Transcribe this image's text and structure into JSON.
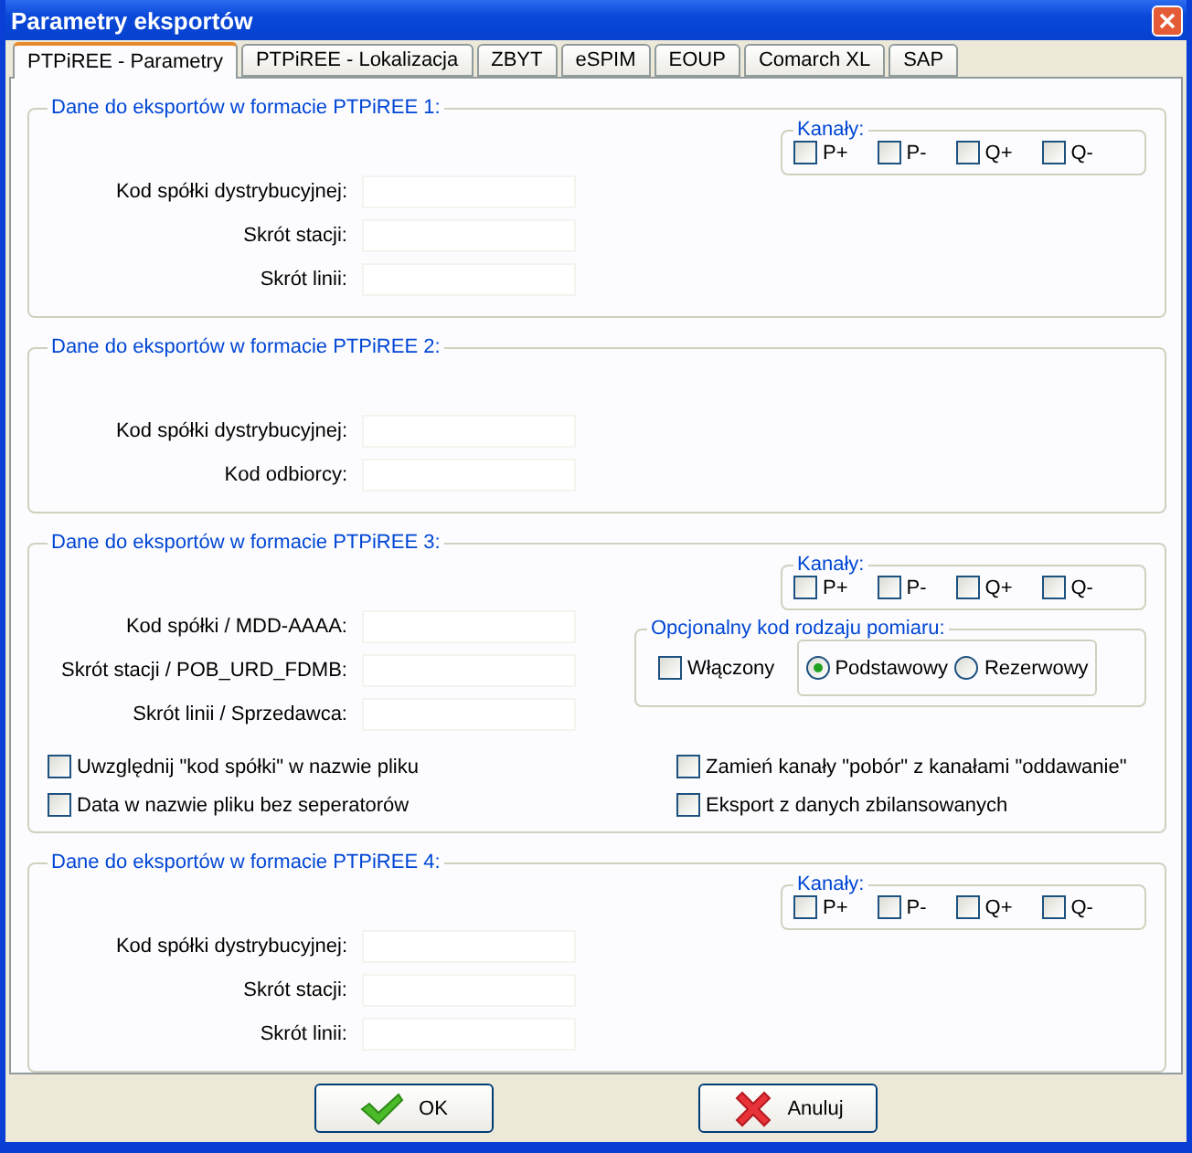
{
  "window": {
    "title": "Parametry eksportów"
  },
  "tabs": [
    {
      "label": "PTPiREE - Parametry",
      "selected": true
    },
    {
      "label": "PTPiREE - Lokalizacja",
      "selected": false
    },
    {
      "label": "ZBYT",
      "selected": false
    },
    {
      "label": "eSPIM",
      "selected": false
    },
    {
      "label": "EOUP",
      "selected": false
    },
    {
      "label": "Comarch XL",
      "selected": false
    },
    {
      "label": "SAP",
      "selected": false
    }
  ],
  "groups": [
    {
      "title": "Dane do eksportów w formacie PTPiREE 1:",
      "channels": {
        "title": "Kanały:",
        "items": [
          {
            "label": "P+",
            "checked": false
          },
          {
            "label": "P-",
            "checked": false
          },
          {
            "label": "Q+",
            "checked": false
          },
          {
            "label": "Q-",
            "checked": false
          }
        ]
      },
      "fields": [
        {
          "label": "Kod spółki dystrybucyjnej:"
        },
        {
          "label": "Skrót stacji:"
        },
        {
          "label": "Skrót linii:"
        }
      ]
    },
    {
      "title": "Dane do eksportów w formacie PTPiREE 2:",
      "fields": [
        {
          "label": "Kod spółki dystrybucyjnej:"
        },
        {
          "label": "Kod odbiorcy:"
        }
      ]
    },
    {
      "title": "Dane do eksportów w formacie PTPiREE 3:",
      "channels": {
        "title": "Kanały:",
        "items": [
          {
            "label": "P+",
            "checked": false
          },
          {
            "label": "P-",
            "checked": false
          },
          {
            "label": "Q+",
            "checked": false
          },
          {
            "label": "Q-",
            "checked": false
          }
        ]
      },
      "fields": [
        {
          "label": "Kod spółki / MDD-AAAA:"
        },
        {
          "label": "Skrót stacji / POB_URD_FDMB:"
        },
        {
          "label": "Skrót linii / Sprzedawca:"
        }
      ],
      "optional_code": {
        "title": "Opcjonalny kod rodzaju pomiaru:",
        "enabled": {
          "label": "Włączony",
          "checked": false
        },
        "options": [
          {
            "label": "Podstawowy",
            "selected": true
          },
          {
            "label": "Rezerwowy",
            "selected": false
          }
        ]
      },
      "checkboxes_left": [
        {
          "label": "Uwzględnij \"kod spółki\" w nazwie pliku",
          "checked": false
        },
        {
          "label": "Data w nazwie pliku bez seperatorów",
          "checked": false
        }
      ],
      "checkboxes_right": [
        {
          "label": "Zamień kanały \"pobór\" z kanałami \"oddawanie\"",
          "checked": false
        },
        {
          "label": "Eksport z danych zbilansowanych",
          "checked": false
        }
      ]
    },
    {
      "title": "Dane do eksportów w formacie PTPiREE 4:",
      "channels": {
        "title": "Kanały:",
        "items": [
          {
            "label": "P+",
            "checked": false
          },
          {
            "label": "P-",
            "checked": false
          },
          {
            "label": "Q+",
            "checked": false
          },
          {
            "label": "Q-",
            "checked": false
          }
        ]
      },
      "fields": [
        {
          "label": "Kod spółki dystrybucyjnej:"
        },
        {
          "label": "Skrót stacji:"
        },
        {
          "label": "Skrót linii:"
        }
      ]
    }
  ],
  "buttons": [
    {
      "kind": "ok",
      "label": "OK"
    },
    {
      "kind": "cancel",
      "label": "Anuluj"
    }
  ]
}
